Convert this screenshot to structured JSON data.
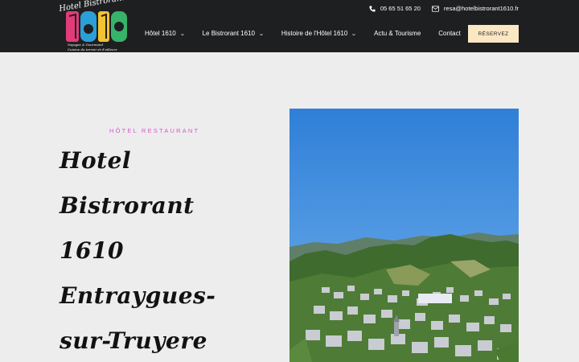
{
  "brand": {
    "logo_text_top": "Hotel Bistrorant",
    "logo_number": "1610",
    "logo_tagline_1": "Voyages & Gourmand",
    "logo_tagline_2": "Cuisine du terroir et d'ailleurs"
  },
  "contact": {
    "phone": "05 65 51 65 20",
    "email": "resa@hotelbistrorant1610.fr",
    "phone_icon": "phone-icon",
    "email_icon": "mail-icon"
  },
  "nav": {
    "items": [
      {
        "label": "Hôtel 1610",
        "has_dropdown": true
      },
      {
        "label": "Le Bistrorant 1610",
        "has_dropdown": true
      },
      {
        "label": "Histoire de l'Hôtel 1610",
        "has_dropdown": true
      },
      {
        "label": "Actu & Tourisme",
        "has_dropdown": false
      },
      {
        "label": "Contact",
        "has_dropdown": false
      }
    ],
    "cta": "RÉSERVEZ"
  },
  "hero": {
    "kicker": "HÔTEL RESTAURANT",
    "title_line_1": "Hotel Bistrorant",
    "title_line_2": "1610 Entraygues-",
    "title_line_3": "sur-Truyere"
  },
  "colors": {
    "header_bg": "#1e1f21",
    "page_bg": "#ededee",
    "accent_pink": "#d657c8",
    "cta_bg": "#fbe7c4"
  }
}
